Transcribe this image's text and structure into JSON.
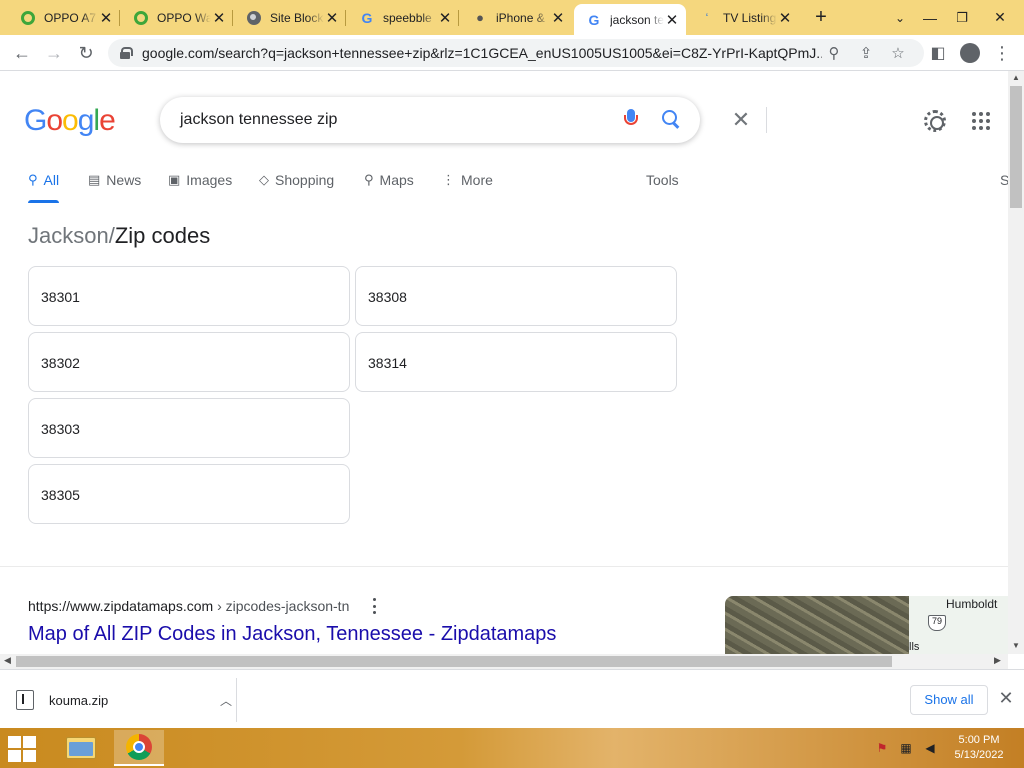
{
  "browser": {
    "tabs": [
      {
        "title": "OPPO A7",
        "favicon": "opera-icon"
      },
      {
        "title": "OPPO Wat",
        "favicon": "opera-icon"
      },
      {
        "title": "Site Block",
        "favicon": "globe-icon"
      },
      {
        "title": "speebble",
        "favicon": "google-icon"
      },
      {
        "title": "iPhone &",
        "favicon": "apple-icon"
      },
      {
        "title": "jackson te",
        "favicon": "google-icon",
        "active": true
      },
      {
        "title": "TV Listing",
        "favicon": "tv-icon"
      }
    ],
    "new_tab_label": "+",
    "url": "google.com/search?q=jackson+tennessee+zip&rlz=1C1GCEA_enUS1005US1005&ei=C8Z-YrPrI-KaptQPmJ..."
  },
  "search": {
    "logo_text": "Google",
    "query": "jackson tennessee zip",
    "nav_tabs": [
      {
        "label": "All",
        "icon": "search-icon",
        "active": true
      },
      {
        "label": "News",
        "icon": "news-icon"
      },
      {
        "label": "Images",
        "icon": "image-icon"
      },
      {
        "label": "Shopping",
        "icon": "tag-icon"
      },
      {
        "label": "Maps",
        "icon": "map-pin-icon"
      },
      {
        "label": "More",
        "icon": "more-vert-icon"
      }
    ],
    "tools_label": "Tools",
    "cut_label": "S"
  },
  "zips": {
    "breadcrumb_place": "Jackson",
    "breadcrumb_sep": "/",
    "breadcrumb_current": "Zip codes",
    "codes": [
      "38301",
      "38308",
      "38302",
      "38314",
      "38303",
      "38305"
    ]
  },
  "result": {
    "cite_host": "https://www.zipdatamaps.com",
    "cite_path": " › zipcodes-jackson-tn",
    "title": "Map of All ZIP Codes in Jackson, Tennessee - Zipdatamaps",
    "map_label": "Humboldt",
    "map_shield": "79",
    "map_cut": "lls"
  },
  "downloads": {
    "file_name": "kouma.zip",
    "show_all_label": "Show all"
  },
  "taskbar": {
    "time": "5:00 PM",
    "date": "5/13/2022"
  },
  "colors": {
    "tabstrip": "#f5d77e",
    "link": "#1a0dab",
    "accent": "#1a73e8"
  }
}
